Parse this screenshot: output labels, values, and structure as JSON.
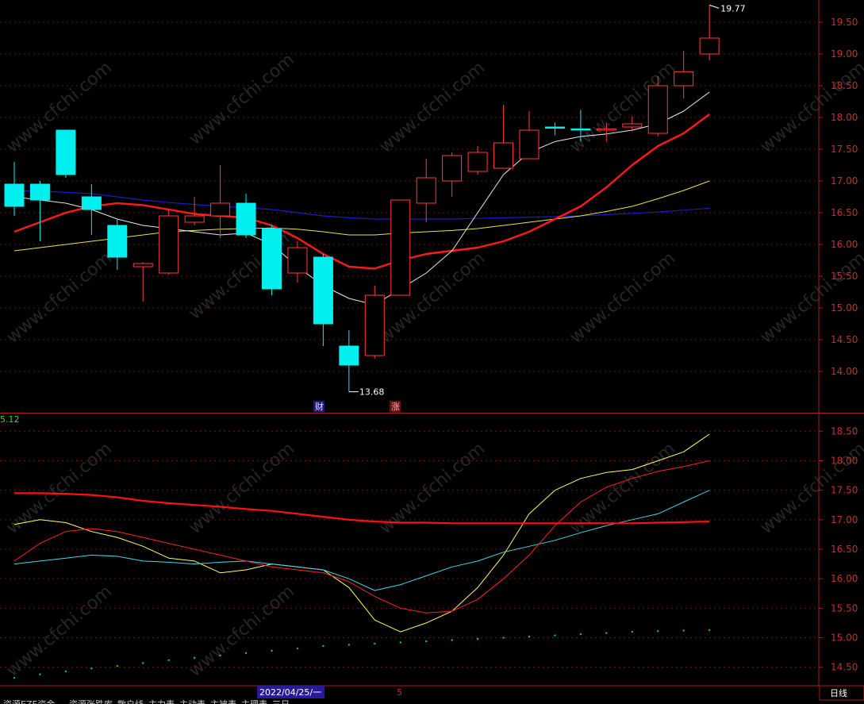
{
  "watermark": "www.cfchi.com",
  "colors": {
    "background": "#000000",
    "frame": "#b01c1c",
    "grid": "#6a1414",
    "up": "#ff3b3b",
    "down": "#00f0f0",
    "ma_white": "#e8e8e8",
    "ma_red": "#ff1a1a",
    "ma_yellow": "#e6e640",
    "ma_blue": "#1a1acc",
    "ind_yellow": "#ffff66",
    "ind_cyan": "#40d8e8",
    "ind_red": "#ff2222",
    "ind_thick": "#ff1010",
    "dots": "#22cc22",
    "date_bg": "#2a1a9a"
  },
  "main_axis": {
    "ticks": [
      "19.50",
      "19.00",
      "18.50",
      "18.00",
      "17.50",
      "17.00",
      "16.50",
      "16.00",
      "15.50",
      "15.00",
      "14.50",
      "14.00"
    ],
    "high_label": "19.77",
    "low_label": "13.68",
    "marker_cai": "财",
    "marker_zhang": "涨"
  },
  "sub_axis": {
    "ticks": [
      "18.50",
      "18.00",
      "17.50",
      "17.00",
      "16.50",
      "16.00",
      "15.50",
      "15.00",
      "14.50"
    ],
    "corner_value": "5.12"
  },
  "bottom": {
    "date": "2022/04/25/一",
    "tick": "5",
    "period": "日线",
    "tabs": [
      "资源EZE资金",
      "资源张跌库",
      "散户线",
      "主力表",
      "主动表",
      "主被表",
      "主理表",
      "三日"
    ]
  },
  "chart_data": [
    {
      "type": "candlestick",
      "ylim": [
        13.35,
        19.85
      ],
      "high_label": "19.77",
      "low_label": "13.68",
      "candles": [
        {
          "o": 16.95,
          "c": 16.6,
          "h": 17.3,
          "l": 16.45
        },
        {
          "o": 16.95,
          "c": 16.7,
          "h": 17.0,
          "l": 16.05
        },
        {
          "o": 17.8,
          "c": 17.1,
          "h": 17.8,
          "l": 17.05
        },
        {
          "o": 16.75,
          "c": 16.55,
          "h": 16.95,
          "l": 16.15
        },
        {
          "o": 16.3,
          "c": 15.8,
          "h": 16.4,
          "l": 15.6
        },
        {
          "o": 15.65,
          "c": 15.7,
          "h": 15.72,
          "l": 15.1
        },
        {
          "o": 15.55,
          "c": 16.45,
          "h": 16.55,
          "l": 15.52
        },
        {
          "o": 16.35,
          "c": 16.45,
          "h": 16.75,
          "l": 16.3
        },
        {
          "o": 16.45,
          "c": 16.65,
          "h": 17.25,
          "l": 16.1
        },
        {
          "o": 16.65,
          "c": 16.15,
          "h": 16.8,
          "l": 16.1
        },
        {
          "o": 16.25,
          "c": 15.3,
          "h": 16.3,
          "l": 15.2
        },
        {
          "o": 15.55,
          "c": 15.95,
          "h": 16.05,
          "l": 15.4
        },
        {
          "o": 15.8,
          "c": 14.75,
          "h": 15.85,
          "l": 14.4
        },
        {
          "o": 14.4,
          "c": 14.1,
          "h": 14.65,
          "l": 13.68
        },
        {
          "o": 14.25,
          "c": 15.2,
          "h": 15.35,
          "l": 14.2
        },
        {
          "o": 15.2,
          "c": 16.7,
          "h": 16.7,
          "l": 15.2
        },
        {
          "o": 16.65,
          "c": 17.05,
          "h": 17.35,
          "l": 16.35
        },
        {
          "o": 17.0,
          "c": 17.4,
          "h": 17.45,
          "l": 16.75
        },
        {
          "o": 17.15,
          "c": 17.45,
          "h": 17.55,
          "l": 17.1
        },
        {
          "o": 17.2,
          "c": 17.6,
          "h": 18.2,
          "l": 17.2
        },
        {
          "o": 17.35,
          "c": 17.8,
          "h": 18.1,
          "l": 17.35
        },
        {
          "o": 17.85,
          "c": 17.84,
          "h": 17.92,
          "l": 17.72
        },
        {
          "o": 17.82,
          "c": 17.81,
          "h": 18.12,
          "l": 17.62
        },
        {
          "o": 17.8,
          "c": 17.82,
          "h": 17.92,
          "l": 17.62
        },
        {
          "o": 17.85,
          "c": 17.9,
          "h": 18.02,
          "l": 17.78
        },
        {
          "o": 17.75,
          "c": 18.5,
          "h": 18.65,
          "l": 17.7
        },
        {
          "o": 18.5,
          "c": 18.72,
          "h": 19.05,
          "l": 18.3
        },
        {
          "o": 19.0,
          "c": 19.25,
          "h": 19.77,
          "l": 18.9
        }
      ],
      "ma_white": [
        16.75,
        16.7,
        16.65,
        16.55,
        16.4,
        16.3,
        16.25,
        16.2,
        16.15,
        16.18,
        16.0,
        15.65,
        15.35,
        15.15,
        15.05,
        15.3,
        15.55,
        15.9,
        16.5,
        17.1,
        17.45,
        17.62,
        17.7,
        17.74,
        17.8,
        17.9,
        18.1,
        18.4
      ],
      "ma_red": [
        16.2,
        16.35,
        16.5,
        16.6,
        16.65,
        16.62,
        16.55,
        16.48,
        16.45,
        16.42,
        16.3,
        16.1,
        15.85,
        15.65,
        15.62,
        15.75,
        15.85,
        15.9,
        15.95,
        16.05,
        16.2,
        16.4,
        16.6,
        16.9,
        17.25,
        17.55,
        17.75,
        18.05
      ],
      "ma_yellow": [
        15.9,
        15.95,
        16.0,
        16.05,
        16.1,
        16.15,
        16.2,
        16.22,
        16.24,
        16.25,
        16.26,
        16.24,
        16.2,
        16.15,
        16.15,
        16.18,
        16.2,
        16.22,
        16.25,
        16.3,
        16.35,
        16.4,
        16.45,
        16.52,
        16.6,
        16.72,
        16.85,
        17.0
      ],
      "ma_blue": [
        16.85,
        16.84,
        16.82,
        16.8,
        16.75,
        16.7,
        16.66,
        16.63,
        16.6,
        16.58,
        16.55,
        16.5,
        16.45,
        16.42,
        16.4,
        16.4,
        16.4,
        16.4,
        16.41,
        16.42,
        16.43,
        16.44,
        16.45,
        16.47,
        16.49,
        16.51,
        16.54,
        16.57
      ]
    },
    {
      "type": "line",
      "ylim": [
        14.2,
        18.8
      ],
      "corner_value": "5.12",
      "series": [
        {
          "color": "#ffff66",
          "values": [
            16.92,
            17.0,
            16.95,
            16.8,
            16.7,
            16.55,
            16.35,
            16.3,
            16.1,
            16.15,
            16.25,
            16.2,
            16.15,
            15.85,
            15.3,
            15.1,
            15.25,
            15.45,
            15.85,
            16.4,
            17.1,
            17.5,
            17.7,
            17.8,
            17.85,
            18.0,
            18.15,
            18.45
          ]
        },
        {
          "color": "#40d8e8",
          "values": [
            16.25,
            16.3,
            16.35,
            16.4,
            16.38,
            16.3,
            16.28,
            16.25,
            16.28,
            16.3,
            16.25,
            16.2,
            16.15,
            16.0,
            15.8,
            15.9,
            16.05,
            16.2,
            16.3,
            16.45,
            16.55,
            16.65,
            16.78,
            16.9,
            17.0,
            17.1,
            17.3,
            17.5
          ]
        },
        {
          "color": "#ff2222",
          "values": [
            16.3,
            16.6,
            16.8,
            16.85,
            16.8,
            16.7,
            16.6,
            16.5,
            16.4,
            16.3,
            16.2,
            16.15,
            16.1,
            15.95,
            15.7,
            15.5,
            15.42,
            15.45,
            15.65,
            16.0,
            16.4,
            16.9,
            17.3,
            17.55,
            17.7,
            17.82,
            17.9,
            18.0
          ]
        },
        {
          "color": "#ff1010",
          "values": [
            17.45,
            17.45,
            17.44,
            17.42,
            17.38,
            17.32,
            17.28,
            17.25,
            17.22,
            17.18,
            17.15,
            17.1,
            17.05,
            17.0,
            16.97,
            16.95,
            16.95,
            16.94,
            16.94,
            16.94,
            16.94,
            16.94,
            16.94,
            16.94,
            16.94,
            16.95,
            16.96,
            16.97
          ]
        }
      ],
      "dots": [
        14.32,
        14.38,
        14.43,
        14.48,
        14.52,
        14.57,
        14.62,
        14.66,
        14.7,
        14.74,
        14.78,
        14.82,
        14.86,
        14.88,
        14.9,
        14.92,
        14.94,
        14.96,
        14.98,
        15.0,
        15.02,
        15.04,
        15.06,
        15.08,
        15.1,
        15.11,
        15.12,
        15.13
      ]
    }
  ]
}
